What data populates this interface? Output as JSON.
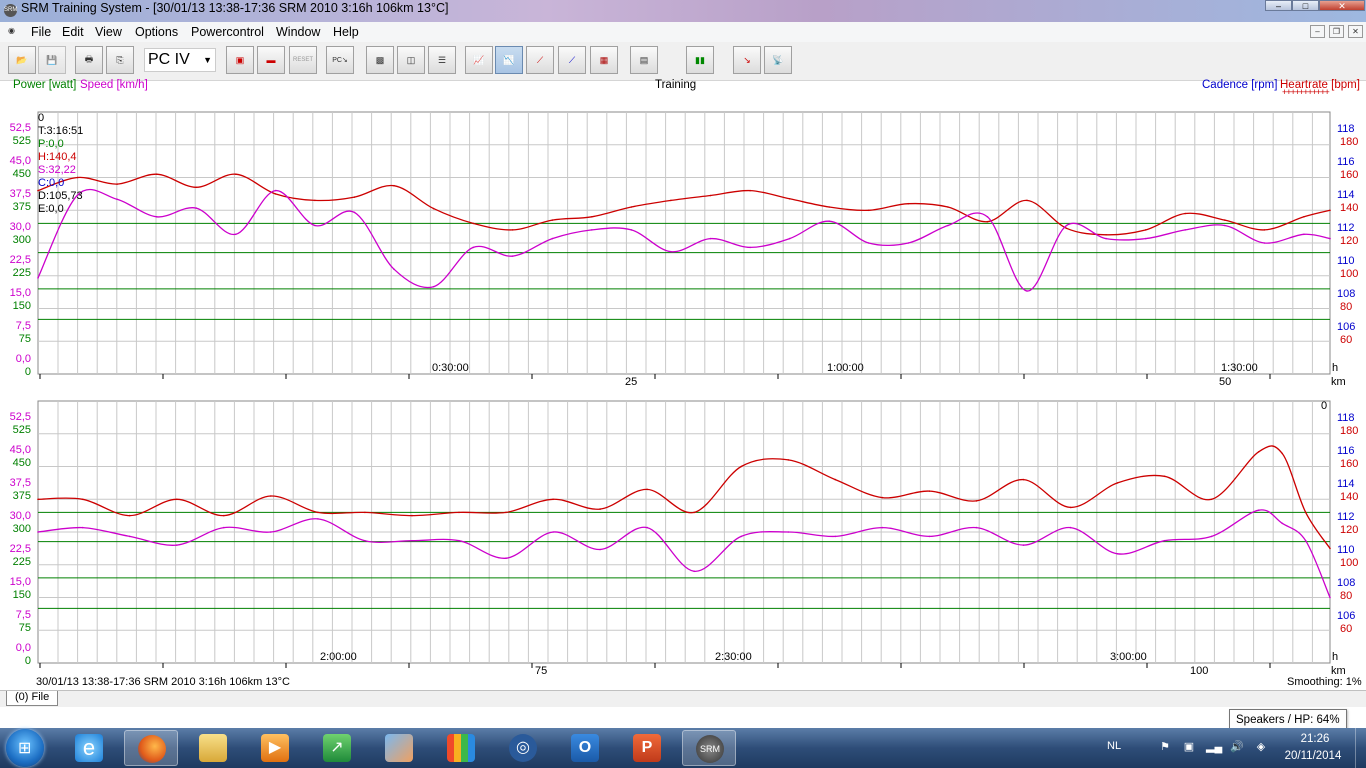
{
  "window": {
    "title": "SRM Training System - [30/01/13 13:38-17:36 SRM 2010 3:16h 106km 13°C]",
    "app_icon": "srm-logo-icon",
    "controls": {
      "minimize": "–",
      "maximize": "□",
      "close": "✕"
    },
    "mdi_controls": {
      "minimize": "–",
      "restore": "❐",
      "close": "✕"
    }
  },
  "menu": [
    "File",
    "Edit",
    "View",
    "Options",
    "Powercontrol",
    "Window",
    "Help"
  ],
  "toolbar": {
    "device_select": "PC IV",
    "reset_label": "RESET",
    "buttons": [
      "open-icon",
      "save-icon",
      "print-icon",
      "copy-icon",
      "pc-transfer-icon",
      "powermeter-icon",
      "reset-icon",
      "pc-su-icon",
      "window-layout-icon",
      "split-vertical-icon",
      "split-horizontal-icon",
      "graph-power-icon",
      "graph-speed-icon",
      "graph-heartrate-icon",
      "graph-cadence-icon",
      "graph-bars-icon",
      "graph-zones-icon",
      "statistics-icon",
      "analysis-icon",
      "wireless-icon"
    ]
  },
  "header": {
    "power_label": "Power [watt]",
    "speed_label": "Speed [km/h]",
    "center_label": "Training",
    "cadence_label": "Cadence [rpm]",
    "heartrate_label": "Heartrate [bpm]"
  },
  "colors": {
    "power": "#008000",
    "speed": "#cc00cc",
    "heartrate": "#cc0000",
    "cadence": "#0000cc",
    "grid": "#c8c8c8",
    "zone_lines": "#008000"
  },
  "cursor_readout": {
    "index": "0",
    "time": "T:3:16:51",
    "power": "P:0,0",
    "heartrate": "H:140,4",
    "speed": "S:32,22",
    "cadence": "C:0,0",
    "distance": "D:105,73",
    "energy": "E:0,0"
  },
  "axes": {
    "speed_ticks": [
      "52,5",
      "45,0",
      "37,5",
      "30,0",
      "22,5",
      "15,0",
      "7,5",
      "0,0"
    ],
    "power_ticks": [
      "525",
      "450",
      "375",
      "300",
      "225",
      "150",
      "75",
      "0"
    ],
    "cadence_ticks": [
      "118",
      "116",
      "114",
      "112",
      "110",
      "108",
      "106"
    ],
    "heartrate_ticks": [
      "180",
      "160",
      "140",
      "120",
      "100",
      "80",
      "60"
    ],
    "time_unit": "h",
    "distance_unit": "km"
  },
  "chart_data": [
    {
      "type": "line",
      "title": "Training",
      "ylabel_left": "Speed [km/h] / Power [watt]",
      "ylabel_right": "Cadence [rpm] / Heartrate [bpm]",
      "x_range_h": [
        0,
        1.633
      ],
      "time_labels": [
        "0:30:00",
        "1:00:00",
        "1:30:00"
      ],
      "distance_labels": [
        "25",
        "50"
      ],
      "speed_range": [
        0,
        60
      ],
      "heartrate_range": [
        40,
        200
      ],
      "zone_lines_watt": [
        125,
        195,
        278,
        345
      ],
      "series": [
        {
          "name": "Heartrate [bpm]",
          "color": "#cc0000",
          "x": [
            0,
            0.05,
            0.1,
            0.15,
            0.2,
            0.25,
            0.3,
            0.35,
            0.4,
            0.45,
            0.5,
            0.55,
            0.6,
            0.65,
            0.7,
            0.75,
            0.8,
            0.85,
            0.9,
            0.95,
            1.0,
            1.05,
            1.1,
            1.15,
            1.2,
            1.25,
            1.3,
            1.35,
            1.4,
            1.45,
            1.5,
            1.55,
            1.6,
            1.633
          ],
          "values": [
            152,
            160,
            156,
            162,
            154,
            162,
            150,
            146,
            148,
            155,
            141,
            132,
            128,
            134,
            136,
            142,
            146,
            149,
            152,
            147,
            142,
            140,
            144,
            142,
            133,
            146,
            129,
            125,
            128,
            138,
            134,
            128,
            136,
            140
          ]
        },
        {
          "name": "Speed [km/h]",
          "color": "#cc00cc",
          "x": [
            0,
            0.05,
            0.1,
            0.15,
            0.2,
            0.25,
            0.3,
            0.35,
            0.4,
            0.45,
            0.5,
            0.55,
            0.6,
            0.65,
            0.7,
            0.75,
            0.8,
            0.85,
            0.9,
            0.95,
            1.0,
            1.05,
            1.1,
            1.15,
            1.2,
            1.25,
            1.3,
            1.35,
            1.4,
            1.45,
            1.5,
            1.55,
            1.6,
            1.633
          ],
          "values": [
            22,
            41,
            40,
            36,
            38,
            32,
            42,
            34,
            37,
            24,
            20,
            29,
            27,
            31,
            33,
            33,
            28,
            31,
            29,
            31,
            35,
            30,
            30,
            34,
            36,
            19,
            34,
            31,
            31,
            33,
            34,
            30,
            32,
            31
          ]
        }
      ]
    },
    {
      "type": "line",
      "x_range_h": [
        1.633,
        3.281
      ],
      "time_labels": [
        "2:00:00",
        "2:30:00",
        "3:00:00"
      ],
      "distance_labels": [
        "75",
        "100"
      ],
      "speed_range": [
        0,
        60
      ],
      "heartrate_range": [
        40,
        200
      ],
      "zone_lines_watt": [
        125,
        195,
        278,
        345
      ],
      "series": [
        {
          "name": "Heartrate [bpm]",
          "color": "#cc0000",
          "x": [
            1.633,
            1.69,
            1.75,
            1.81,
            1.87,
            1.93,
            1.99,
            2.05,
            2.11,
            2.17,
            2.23,
            2.29,
            2.35,
            2.41,
            2.47,
            2.53,
            2.59,
            2.65,
            2.71,
            2.77,
            2.83,
            2.89,
            2.95,
            3.01,
            3.07,
            3.13,
            3.19,
            3.22,
            3.25,
            3.281
          ],
          "values": [
            140,
            140,
            130,
            140,
            130,
            142,
            132,
            132,
            130,
            132,
            132,
            140,
            134,
            146,
            132,
            160,
            164,
            152,
            141,
            145,
            139,
            152,
            135,
            150,
            154,
            140,
            169,
            168,
            132,
            110
          ]
        },
        {
          "name": "Speed [km/h]",
          "color": "#cc00cc",
          "x": [
            1.633,
            1.69,
            1.75,
            1.81,
            1.87,
            1.93,
            1.99,
            2.05,
            2.11,
            2.17,
            2.23,
            2.29,
            2.35,
            2.41,
            2.47,
            2.53,
            2.59,
            2.65,
            2.71,
            2.77,
            2.83,
            2.89,
            2.95,
            3.01,
            3.07,
            3.13,
            3.19,
            3.22,
            3.25,
            3.281
          ],
          "values": [
            30,
            31,
            29,
            27,
            31,
            30,
            33,
            28,
            28,
            28,
            24,
            30,
            26,
            31,
            21,
            29,
            30,
            29,
            31,
            29,
            31,
            27,
            31,
            25,
            28,
            29,
            35,
            32,
            28,
            15
          ]
        }
      ]
    }
  ],
  "status": {
    "footer_title": "30/01/13 13:38-17:36 SRM 2010 3:16h 106km 13°C",
    "smoothing": "Smoothing: 1%",
    "file_tab": "(0) File"
  },
  "tooltip": "Speakers / HP: 64%",
  "taskbar": {
    "apps": [
      "internet-explorer-icon",
      "firefox-icon",
      "file-explorer-icon",
      "media-player-icon",
      "project-icon",
      "picture-viewer-icon",
      "office-icon",
      "network-icon",
      "outlook-icon",
      "powerpoint-icon",
      "srm-icon"
    ],
    "language": "NL",
    "time": "21:26",
    "date": "20/11/2014"
  }
}
